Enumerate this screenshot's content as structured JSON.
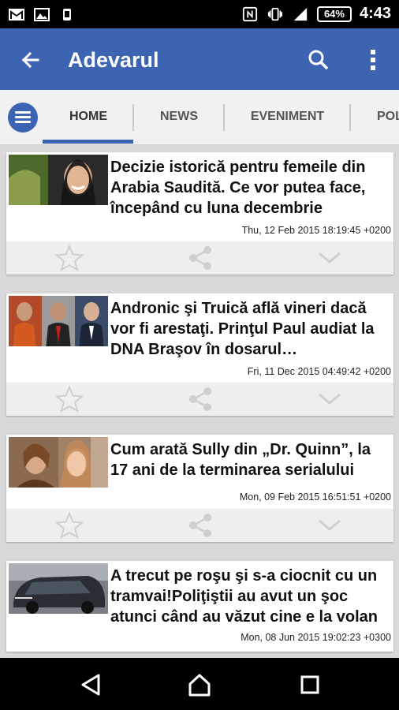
{
  "status_bar": {
    "left_icons": [
      "gmail-icon",
      "image-icon",
      "android-icon"
    ],
    "right_icons": [
      "nfc-icon",
      "vibrate-icon",
      "signal-icon"
    ],
    "battery": "64%",
    "time": "4:43"
  },
  "app_bar": {
    "title": "Adevarul",
    "back_icon": "arrow-back-icon",
    "search_icon": "search-icon",
    "more_icon": "more-vert-icon"
  },
  "tabs": {
    "items": [
      "HOME",
      "NEWS",
      "EVENIMENT",
      "POL"
    ],
    "selected": "HOME"
  },
  "articles": [
    {
      "headline": "Decizie istorică pentru femeile din Arabia Saudită. Ce vor putea face, începând cu luna decembrie",
      "date": "Thu, 12 Feb 2015 18:19:45 +0200"
    },
    {
      "headline": "Andronic şi Truică află vineri dacă vor fi arestaţi. Prinţul Paul audiat la DNA Braşov în dosarul…",
      "date": "Fri, 11 Dec 2015 04:49:42 +0200"
    },
    {
      "headline": "Cum arată Sully din „Dr. Quinn”, la 17 ani de la terminarea serialului",
      "date": "Mon, 09 Feb 2015 16:51:51 +0200"
    },
    {
      "headline": "A trecut pe roşu şi s-a ciocnit cu un tramvai!Poliţiştii au avut un şoc atunci când au văzut cine e la volan",
      "date": "Mon, 08 Jun 2015 19:02:23 +0300"
    }
  ],
  "colors": {
    "primary": "#3d63b3",
    "background": "#d9d9d9"
  }
}
